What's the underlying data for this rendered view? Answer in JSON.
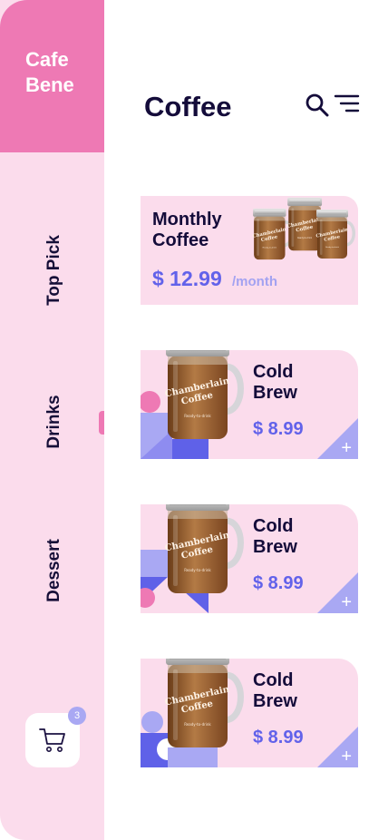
{
  "sidebar": {
    "brand": "Cafe\nBene",
    "nav": [
      {
        "label": "Top Pick"
      },
      {
        "label": "Drinks"
      },
      {
        "label": "Dessert"
      }
    ],
    "cart_icon": "shopping-cart-icon",
    "cart_count": "3"
  },
  "header": {
    "title": "Coffee",
    "search_icon": "search-icon",
    "menu_icon": "menu-icon"
  },
  "featured": {
    "name": "Monthly\nCoffee",
    "price": "$ 12.99",
    "unit": "/month",
    "jar_label": "Chamberlain Coffee"
  },
  "products": [
    {
      "name": "Cold\nBrew",
      "price": "$ 8.99",
      "add_icon": "plus-icon"
    },
    {
      "name": "Cold\nBrew",
      "price": "$ 8.99",
      "add_icon": "plus-icon"
    },
    {
      "name": "Cold\nBrew",
      "price": "$ 8.99",
      "add_icon": "plus-icon"
    }
  ],
  "colors": {
    "accent_pink": "#ee79b4",
    "light_pink": "#fbdcec",
    "accent_purple": "#6262ea",
    "light_purple": "#a3a2f1",
    "text_dark": "#140c3a"
  }
}
